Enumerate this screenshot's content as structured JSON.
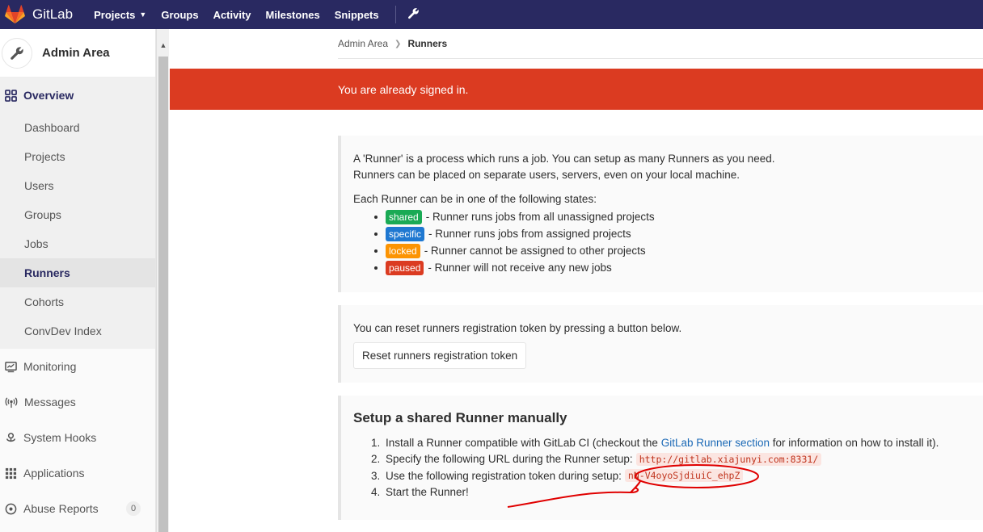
{
  "topbar": {
    "brand": "GitLab",
    "nav": [
      {
        "label": "Projects",
        "dropdown": true
      },
      {
        "label": "Groups"
      },
      {
        "label": "Activity"
      },
      {
        "label": "Milestones"
      },
      {
        "label": "Snippets"
      }
    ],
    "admin_icon": "wrench-icon"
  },
  "sidebar": {
    "title": "Admin Area",
    "overview_label": "Overview",
    "subitems": [
      "Dashboard",
      "Projects",
      "Users",
      "Groups",
      "Jobs",
      "Runners",
      "Cohorts",
      "ConvDev Index"
    ],
    "active_subitem": "Runners",
    "items": [
      {
        "label": "Monitoring",
        "icon": "monitor-icon"
      },
      {
        "label": "Messages",
        "icon": "broadcast-icon"
      },
      {
        "label": "System Hooks",
        "icon": "hook-icon"
      },
      {
        "label": "Applications",
        "icon": "grid-icon"
      },
      {
        "label": "Abuse Reports",
        "icon": "abuse-icon",
        "badge": "0"
      }
    ]
  },
  "breadcrumb": {
    "parent": "Admin Area",
    "current": "Runners"
  },
  "flash": {
    "message": "You are already signed in.",
    "color": "#db3b21"
  },
  "info": {
    "line1": "A 'Runner' is a process which runs a job. You can setup as many Runners as you need.",
    "line2": "Runners can be placed on separate users, servers, even on your local machine.",
    "states_intro": "Each Runner can be in one of the following states:",
    "states": [
      {
        "badge": "shared",
        "color": "#1aaa55",
        "desc": " - Runner runs jobs from all unassigned projects"
      },
      {
        "badge": "specific",
        "color": "#1f78d1",
        "desc": " - Runner runs jobs from assigned projects"
      },
      {
        "badge": "locked",
        "color": "#fc9403",
        "desc": " - Runner cannot be assigned to other projects"
      },
      {
        "badge": "paused",
        "color": "#db3b21",
        "desc": " - Runner will not receive any new jobs"
      }
    ]
  },
  "reset": {
    "text": "You can reset runners registration token by pressing a button below.",
    "button": "Reset runners registration token"
  },
  "setup": {
    "title": "Setup a shared Runner manually",
    "step1_pre": "Install a Runner compatible with GitLab CI (checkout the ",
    "step1_link": "GitLab Runner section",
    "step1_post": " for information on how to install it).",
    "step2": "Specify the following URL during the Runner setup:",
    "url": "http://gitlab.xiajunyi.com:8331/",
    "step3": "Use the following registration token during setup:",
    "token": "nN-V4oyoSjdiuiC_ehpZ",
    "step4": "Start the Runner!"
  }
}
